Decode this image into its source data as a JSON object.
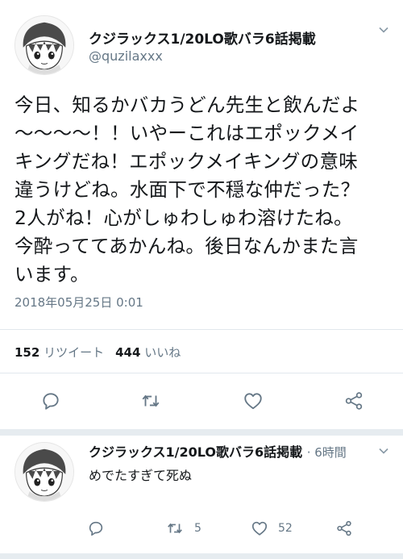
{
  "main_tweet": {
    "display_name": "クジラックス1/20LO歌バラ6話掲載",
    "handle": "@quzilaxxx",
    "lines": [
      "今日、知るかバカうどん先生と飲んだよ",
      "〜〜〜〜！！いやーこれはエポックメイ",
      "キングだね！エポックメイキングの意味",
      "違うけどね。水面下で不穏な仲だった？",
      "2人がね！心がしゅわしゅわ溶けたね。",
      "今酔っててあかんね。後日なんかまた言",
      "います。"
    ],
    "timestamp": "2018年05月25日 0:01",
    "retweet_count": "152",
    "retweet_label": "リツイート",
    "like_count": "444",
    "like_label": "いいね"
  },
  "reply_tweet": {
    "display_name": "クジラックス1/20LO歌バラ6話掲載",
    "time": "· 6時間",
    "text": "めでたすぎて死ぬ",
    "retweet_count": "5",
    "like_count": "52"
  },
  "icons": {
    "reply": "reply-icon",
    "retweet": "retweet-icon",
    "like": "heart-icon",
    "share": "share-icon",
    "menu": "chevron-down-icon"
  },
  "colors": {
    "text": "#14171a",
    "secondary": "#657786",
    "divider": "#e1e8ed",
    "icon": "#657786"
  }
}
